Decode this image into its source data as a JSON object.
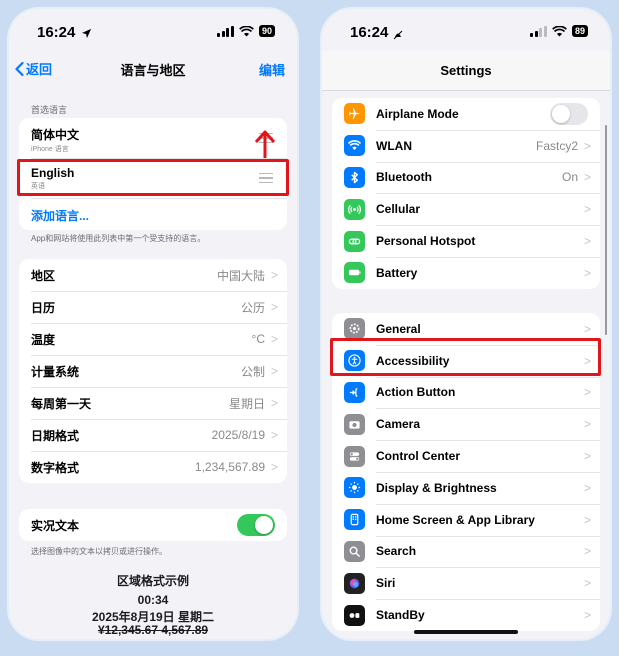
{
  "left": {
    "status": {
      "time": "16:24",
      "battery": "90"
    },
    "nav": {
      "back": "返回",
      "title": "语言与地区",
      "edit": "编辑"
    },
    "preferred_header": "首选语言",
    "languages": [
      {
        "name": "简体中文",
        "sub": "iPhone 语言"
      },
      {
        "name": "English",
        "sub": "英语"
      }
    ],
    "add_language": "添加语言...",
    "languages_footnote": "App和网站将使用此列表中第一个受支持的语言。",
    "region_rows": [
      {
        "label": "地区",
        "value": "中国大陆"
      },
      {
        "label": "日历",
        "value": "公历"
      },
      {
        "label": "温度",
        "value": "°C"
      },
      {
        "label": "计量系统",
        "value": "公制"
      },
      {
        "label": "每周第一天",
        "value": "星期日"
      },
      {
        "label": "日期格式",
        "value": "2025/8/19"
      },
      {
        "label": "数字格式",
        "value": "1,234,567.89"
      }
    ],
    "live_text": {
      "label": "实况文本",
      "on": true
    },
    "live_text_footnote": "选择图像中的文本以拷贝或进行操作。",
    "sample": {
      "title": "区域格式示例",
      "time": "00:34",
      "date": "2025年8月19日 星期二",
      "numbers": "¥12,345.67 4,567.89"
    }
  },
  "right": {
    "status": {
      "time": "16:24",
      "battery": "89"
    },
    "title": "Settings",
    "group1": [
      {
        "icon": "airplane-icon",
        "color": "#ff9500",
        "label": "Airplane Mode",
        "toggle": false
      },
      {
        "icon": "wifi-icon",
        "color": "#007aff",
        "label": "WLAN",
        "value": "Fastcy2"
      },
      {
        "icon": "bluetooth-icon",
        "color": "#007aff",
        "label": "Bluetooth",
        "value": "On"
      },
      {
        "icon": "cellular-icon",
        "color": "#34c759",
        "label": "Cellular"
      },
      {
        "icon": "hotspot-icon",
        "color": "#34c759",
        "label": "Personal Hotspot"
      },
      {
        "icon": "battery-icon",
        "color": "#34c759",
        "label": "Battery"
      }
    ],
    "group2": [
      {
        "icon": "gear-icon",
        "color": "#8e8e93",
        "label": "General"
      },
      {
        "icon": "accessibility-icon",
        "color": "#007aff",
        "label": "Accessibility"
      },
      {
        "icon": "action-button-icon",
        "color": "#007aff",
        "label": "Action Button"
      },
      {
        "icon": "camera-icon",
        "color": "#8e8e93",
        "label": "Camera"
      },
      {
        "icon": "control-center-icon",
        "color": "#8e8e93",
        "label": "Control Center"
      },
      {
        "icon": "brightness-icon",
        "color": "#007aff",
        "label": "Display & Brightness"
      },
      {
        "icon": "home-screen-icon",
        "color": "#007aff",
        "label": "Home Screen & App Library"
      },
      {
        "icon": "search-icon",
        "color": "#8e8e93",
        "label": "Search"
      },
      {
        "icon": "siri-icon",
        "color": "#222222",
        "label": "Siri"
      },
      {
        "icon": "standby-icon",
        "color": "#111111",
        "label": "StandBy"
      }
    ]
  },
  "colors": {
    "highlight": "#e0161b",
    "link": "#007aff",
    "toggle_on": "#34c759"
  }
}
